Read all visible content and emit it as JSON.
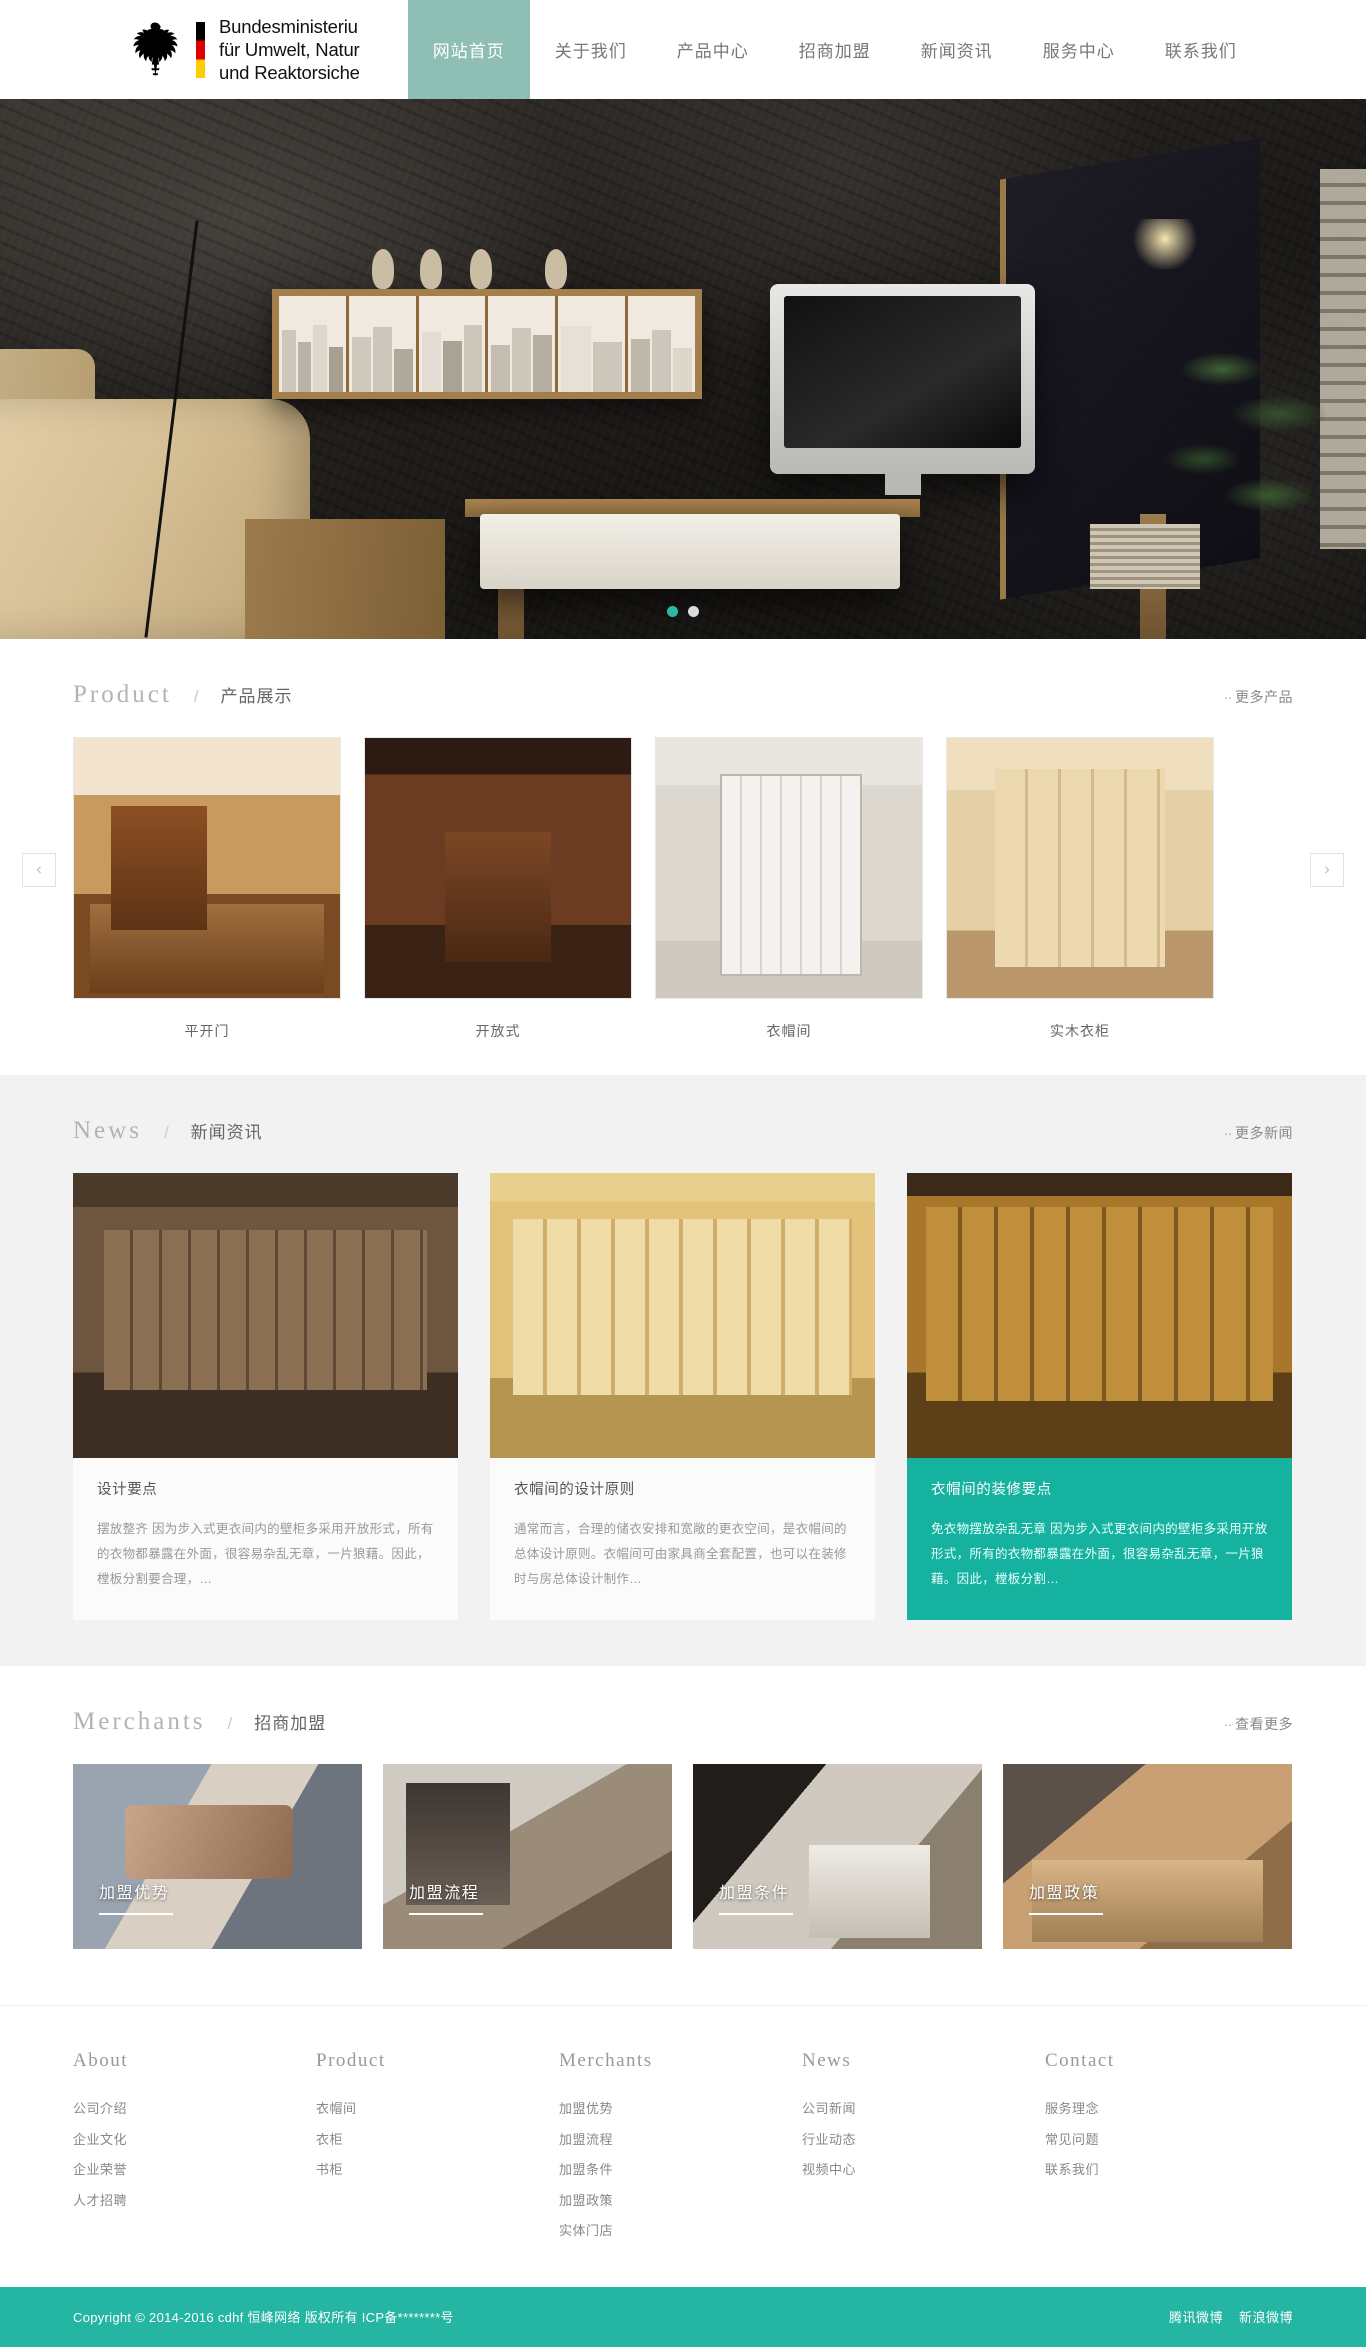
{
  "header": {
    "logo": {
      "emblem": "german-eagle-icon",
      "line1": "Bundesministeriu",
      "line2": "für Umwelt, Natur",
      "line3": "und Reaktorsiche"
    },
    "nav": [
      {
        "label": "网站首页",
        "active": true
      },
      {
        "label": "关于我们",
        "active": false
      },
      {
        "label": "产品中心",
        "active": false
      },
      {
        "label": "招商加盟",
        "active": false
      },
      {
        "label": "新闻资讯",
        "active": false
      },
      {
        "label": "服务中心",
        "active": false
      },
      {
        "label": "联系我们",
        "active": false
      }
    ]
  },
  "banner": {
    "dots": [
      "active",
      "inactive"
    ]
  },
  "product": {
    "en": "Product",
    "slash": "/",
    "cn": "产品展示",
    "more": "更多产品",
    "more_dots": "··",
    "prev": "‹",
    "next": "›",
    "items": [
      {
        "caption": "平开门"
      },
      {
        "caption": "开放式"
      },
      {
        "caption": "衣帽间"
      },
      {
        "caption": "实木衣柜"
      }
    ]
  },
  "news": {
    "en": "News",
    "slash": "/",
    "cn": "新闻资讯",
    "more": "更多新闻",
    "more_dots": "··",
    "items": [
      {
        "title": "设计要点",
        "desc": "摆放整齐 因为步入式更衣间内的壁柜多采用开放形式，所有的衣物都暴露在外面，很容易杂乱无章，一片狼藉。因此，樘板分割要合理，…"
      },
      {
        "title": "衣帽间的设计原则",
        "desc": "通常而言，合理的储衣安排和宽敞的更衣空间，是衣帽间的总体设计原则。衣帽间可由家具商全套配置，也可以在装修时与房总体设计制作…"
      },
      {
        "title": "衣帽间的装修要点",
        "desc": "免衣物摆放杂乱无章 因为步入式更衣间内的壁柜多采用开放形式，所有的衣物都暴露在外面，很容易杂乱无章，一片狼藉。因此，樘板分割…"
      }
    ]
  },
  "merchants": {
    "en": "Merchants",
    "slash": "/",
    "cn": "招商加盟",
    "more": "查看更多",
    "more_dots": "··",
    "items": [
      {
        "label": "加盟优势"
      },
      {
        "label": "加盟流程"
      },
      {
        "label": "加盟条件"
      },
      {
        "label": "加盟政策"
      }
    ]
  },
  "footer": {
    "columns": [
      {
        "head": "About",
        "links": [
          "公司介绍",
          "企业文化",
          "企业荣誉",
          "人才招聘"
        ]
      },
      {
        "head": "Product",
        "links": [
          "衣帽间",
          "衣柜",
          "书柜"
        ]
      },
      {
        "head": "Merchants",
        "links": [
          "加盟优势",
          "加盟流程",
          "加盟条件",
          "加盟政策",
          "实体门店"
        ]
      },
      {
        "head": "News",
        "links": [
          "公司新闻",
          "行业动态",
          "视频中心"
        ]
      },
      {
        "head": "Contact",
        "links": [
          "服务理念",
          "常见问题",
          "联系我们"
        ]
      }
    ]
  },
  "copyright": {
    "text": "Copyright © 2014-2016 cdhf 恒峰网络 版权所有  ICP备********号",
    "social": [
      "腾讯微博",
      "新浪微博"
    ]
  },
  "colors": {
    "accent": "#25b5a3",
    "nav_active": "#8fbfb4",
    "news_highlight": "#15b2a0"
  }
}
